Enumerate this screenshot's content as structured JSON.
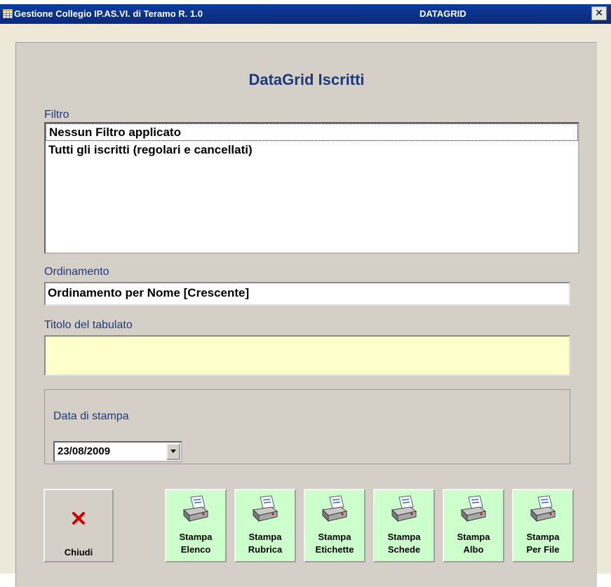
{
  "titlebar": {
    "title": "Gestione Collegio IP.AS.VI. di Teramo R. 1.0",
    "form_name": "DATAGRID",
    "close_glyph": "✕",
    "icon": "datasheet-icon"
  },
  "form": {
    "heading": "DataGrid  Iscritti",
    "filter": {
      "label": "Filtro",
      "items": [
        "Nessun Filtro applicato",
        "Tutti gli iscritti (regolari e cancellati)"
      ],
      "selected_index": 0
    },
    "sort": {
      "label": "Ordinamento",
      "value": "Ordinamento per Nome [Crescente]"
    },
    "report_title": {
      "label": "Titolo del tabulato",
      "value": "",
      "background": "#ffffcc"
    },
    "print_date": {
      "label": "Data di stampa",
      "value": "23/08/2009"
    }
  },
  "buttons": {
    "close": {
      "label": "Chiudi",
      "icon": "red-x-icon",
      "icon_color": "#cc0000"
    },
    "print": [
      {
        "line1": "Stampa",
        "line2": "Elenco",
        "icon": "printer-icon"
      },
      {
        "line1": "Stampa",
        "line2": "Rubrica",
        "icon": "printer-icon"
      },
      {
        "line1": "Stampa",
        "line2": "Etichette",
        "icon": "printer-icon"
      },
      {
        "line1": "Stampa",
        "line2": "Schede",
        "icon": "printer-icon"
      },
      {
        "line1": "Stampa",
        "line2": "Albo",
        "icon": "printer-icon"
      },
      {
        "line1": "Stampa",
        "line2": "Per File",
        "icon": "printer-icon"
      }
    ],
    "print_button_color": "#ccffcc"
  },
  "colors": {
    "titlebar": "#0c2f86",
    "form_bg": "#d4d0c8",
    "label_text": "#1f3a7a"
  }
}
